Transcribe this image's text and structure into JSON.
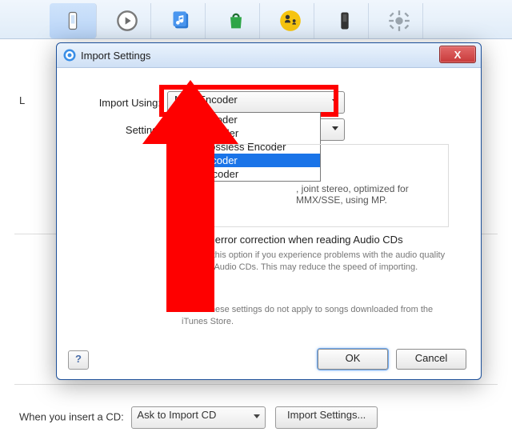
{
  "toolbar": {
    "tabs": [
      "device",
      "play",
      "music",
      "store",
      "parental",
      "ipod",
      "settings"
    ]
  },
  "background": {
    "insert_cd_label": "When you insert a CD:",
    "insert_cd_value": "Ask to Import CD",
    "import_settings_button": "Import Settings...",
    "left_glimpse": "L"
  },
  "dialog": {
    "title": "Import Settings",
    "close": "X",
    "import_using_label": "Import Using:",
    "import_using_value": "MP3 Encoder",
    "setting_label": "Setting:",
    "setting_value": "",
    "dropdown": {
      "opt0": "AAC Encoder",
      "opt1": "AIFF Encoder",
      "opt2": "Apple Lossless Encoder",
      "opt3": "MP3 Encoder",
      "opt4": "WAV Encoder"
    },
    "details_tail": ", joint stereo, optimized for MMX/SSE, using MP.",
    "error_checkbox": "Use error correction when reading Audio CDs",
    "error_hint": "Use this option if you experience problems with the audio quality from Audio CDs. This may reduce the speed of importing.",
    "note": "Note: These settings do not apply to songs downloaded from the iTunes Store.",
    "help": "?",
    "ok": "OK",
    "cancel": "Cancel"
  }
}
